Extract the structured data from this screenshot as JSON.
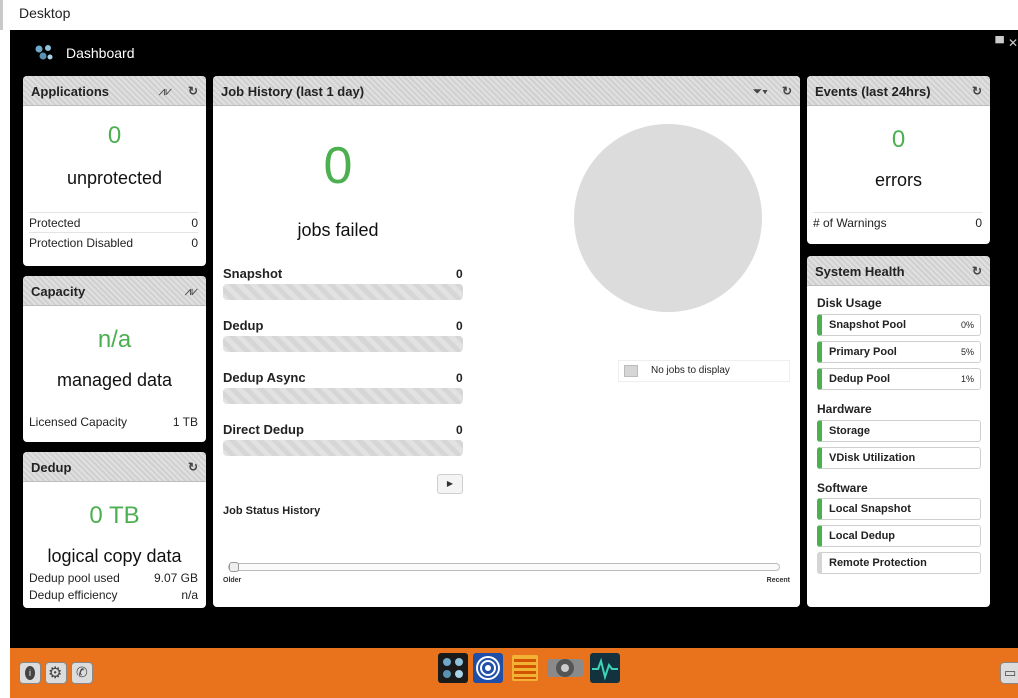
{
  "desktop": {
    "label": "Desktop"
  },
  "app": {
    "title": "Dashboard"
  },
  "applications": {
    "title": "Applications",
    "count": "0",
    "count_label": "unprotected",
    "rows": [
      {
        "label": "Protected",
        "value": "0"
      },
      {
        "label": "Protection Disabled",
        "value": "0"
      }
    ]
  },
  "capacity": {
    "title": "Capacity",
    "value": "n/a",
    "value_label": "managed data",
    "rows": [
      {
        "label": "Licensed Capacity",
        "value": "1 TB"
      }
    ]
  },
  "dedup": {
    "title": "Dedup",
    "value": "0 TB",
    "value_label": "logical copy data",
    "rows": [
      {
        "label": "Dedup pool used",
        "value": "9.07 GB"
      },
      {
        "label": "Dedup efficiency",
        "value": "n/a"
      }
    ]
  },
  "job_history": {
    "title": "Job History (last 1 day)",
    "failed_count": "0",
    "failed_label": "jobs failed",
    "jobs": [
      {
        "label": "Snapshot",
        "value": "0"
      },
      {
        "label": "Dedup",
        "value": "0"
      },
      {
        "label": "Dedup Async",
        "value": "0"
      },
      {
        "label": "Direct Dedup",
        "value": "0"
      }
    ],
    "legend_text": "No jobs to display",
    "status_history_label": "Job Status History",
    "timeline_older": "Older",
    "timeline_recent": "Recent"
  },
  "events": {
    "title": "Events (last 24hrs)",
    "count": "0",
    "count_label": "errors",
    "rows": [
      {
        "label": "# of Warnings",
        "value": "0"
      }
    ]
  },
  "system_health": {
    "title": "System Health",
    "disk_usage_label": "Disk Usage",
    "disk_items": [
      {
        "label": "Snapshot Pool",
        "value": "0%"
      },
      {
        "label": "Primary Pool",
        "value": "5%"
      },
      {
        "label": "Dedup Pool",
        "value": "1%"
      }
    ],
    "hardware_label": "Hardware",
    "hardware_items": [
      {
        "label": "Storage"
      },
      {
        "label": "VDisk Utilization"
      }
    ],
    "software_label": "Software",
    "software_items": [
      {
        "label": "Local Snapshot",
        "status": "ok"
      },
      {
        "label": "Local Dedup",
        "status": "ok"
      },
      {
        "label": "Remote Protection",
        "status": "none"
      }
    ]
  },
  "colors": {
    "accent_green": "#4caf50",
    "taskbar_orange": "#e9731d",
    "app_background": "#000000"
  },
  "icons": {
    "refresh": "refresh-icon",
    "chart": "chart-icon",
    "filter": "filter-icon"
  }
}
